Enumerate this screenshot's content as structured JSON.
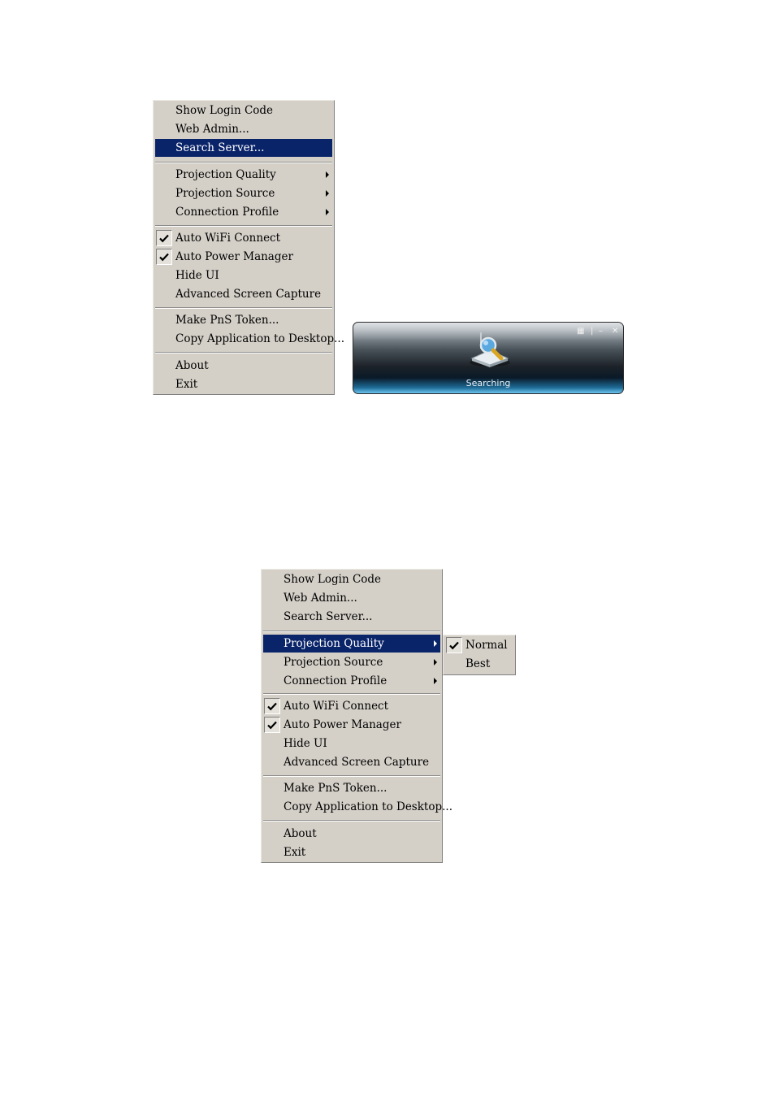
{
  "menu_top": {
    "items": [
      {
        "label": "Show Login Code"
      },
      {
        "label": "Web Admin..."
      },
      {
        "label": "Search Server..."
      },
      {
        "label": "Projection Quality"
      },
      {
        "label": "Projection Source"
      },
      {
        "label": "Connection Profile"
      },
      {
        "label": "Auto WiFi Connect"
      },
      {
        "label": "Auto Power Manager"
      },
      {
        "label": "Hide UI"
      },
      {
        "label": "Advanced Screen Capture"
      },
      {
        "label": "Make PnS Token..."
      },
      {
        "label": "Copy Application to Desktop..."
      },
      {
        "label": "About"
      },
      {
        "label": "Exit"
      }
    ],
    "highlighted": "Search Server...",
    "checked": [
      "Auto WiFi Connect",
      "Auto Power Manager"
    ]
  },
  "menu_bottom": {
    "items": [
      {
        "label": "Show Login Code"
      },
      {
        "label": "Web Admin..."
      },
      {
        "label": "Search Server..."
      },
      {
        "label": "Projection Quality"
      },
      {
        "label": "Projection Source"
      },
      {
        "label": "Connection Profile"
      },
      {
        "label": "Auto WiFi Connect"
      },
      {
        "label": "Auto Power Manager"
      },
      {
        "label": "Hide UI"
      },
      {
        "label": "Advanced Screen Capture"
      },
      {
        "label": "Make PnS Token..."
      },
      {
        "label": "Copy Application to Desktop..."
      },
      {
        "label": "About"
      },
      {
        "label": "Exit"
      }
    ],
    "highlighted": "Projection Quality",
    "checked": [
      "Auto WiFi Connect",
      "Auto Power Manager"
    ]
  },
  "submenu_quality": {
    "items": [
      {
        "label": "Normal"
      },
      {
        "label": "Best"
      }
    ],
    "checked": "Normal"
  },
  "widget": {
    "status": "Searching",
    "icon": "searching-server-icon"
  },
  "colors": {
    "menu_bg": "#d4d0c8",
    "highlight": "#0a246a"
  }
}
